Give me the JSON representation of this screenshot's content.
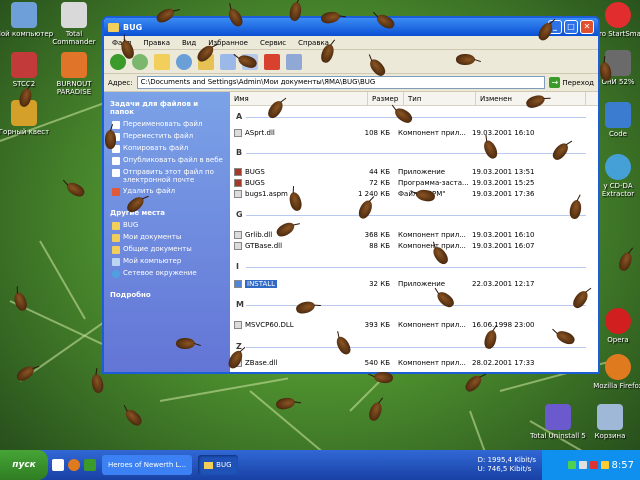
{
  "desktop": {
    "icons": [
      {
        "label": "Мой компьютер",
        "color": "#6f9fd8"
      },
      {
        "label": "Total Commander",
        "color": "#d9d9d9"
      },
      {
        "label": "STCC2",
        "color": "#c23a3a"
      },
      {
        "label": "BURNOUT PARADISE",
        "color": "#e0752a"
      },
      {
        "label": "Горный квест",
        "color": "#d4a02a"
      },
      {
        "label": "Nero StartSmart",
        "color": "#e12d2d"
      },
      {
        "label": "ОнИ 52%",
        "color": "#6a6a6a"
      },
      {
        "label": "Code",
        "color": "#3b7bd0"
      },
      {
        "label": "y CD-DA Extractor",
        "color": "#45a0d8"
      },
      {
        "label": "Opera",
        "color": "#d11f1f"
      },
      {
        "label": "Mozilla Firefox",
        "color": "#e07a1f"
      },
      {
        "label": "Total Uninstall 5",
        "color": "#6a5acd"
      },
      {
        "label": "Корзина",
        "color": "#9fb8d8"
      }
    ]
  },
  "window": {
    "title": "BUG",
    "menu": [
      "Файл",
      "Правка",
      "Вид",
      "Избранное",
      "Сервис",
      "Справка"
    ],
    "address_label": "Адрес:",
    "address_value": "C:\\Documents and Settings\\Admin\\Мои документы\\ЯМА\\BUG\\BUG",
    "go_label": "Переход"
  },
  "taskpane": {
    "file_tasks_title": "Задачи для файлов и папок",
    "file_tasks": [
      "Переименовать файл",
      "Переместить файл",
      "Копировать файл",
      "Опубликовать файл в вебе",
      "Отправить этот файл по электронной почте",
      "Удалить файл"
    ],
    "other_places_title": "Другие места",
    "other_places": [
      "BUG",
      "Мои документы",
      "Общие документы",
      "Мой компьютер",
      "Сетевое окружение"
    ],
    "details_title": "Подробно"
  },
  "filelist": {
    "columns": {
      "name": "Имя",
      "size": "Размер",
      "type": "Тип",
      "modified": "Изменен"
    },
    "groups": [
      {
        "letter": "A",
        "files": [
          {
            "name": "ASprt.dll",
            "size": "108 КБ",
            "type": "Компонент прил...",
            "date": "19.03.2001 16:10"
          }
        ]
      },
      {
        "letter": "B",
        "files": [
          {
            "name": "BUGS",
            "size": "44 КБ",
            "type": "Приложение",
            "date": "19.03.2001 13:51"
          },
          {
            "name": "BUGS",
            "size": "72 КБ",
            "type": "Программа-заста...",
            "date": "19.03.2001 15:25"
          },
          {
            "name": "bugs1.aspm",
            "size": "1 240 КБ",
            "type": "Файл \"ASPM\"",
            "date": "19.03.2001 17:36"
          }
        ]
      },
      {
        "letter": "G",
        "files": [
          {
            "name": "Grlib.dll",
            "size": "368 КБ",
            "type": "Компонент прил...",
            "date": "19.03.2001 16:10"
          },
          {
            "name": "GTBase.dll",
            "size": "88 КБ",
            "type": "Компонент прил...",
            "date": "19.03.2001 16:07"
          }
        ]
      },
      {
        "letter": "I",
        "files": [
          {
            "name": "INSTALL",
            "size": "32 КБ",
            "type": "Приложение",
            "date": "22.03.2001 12:17",
            "selected": true
          }
        ]
      },
      {
        "letter": "M",
        "files": [
          {
            "name": "MSVCP60.DLL",
            "size": "393 КБ",
            "type": "Компонент прил...",
            "date": "16.06.1998 23:00"
          }
        ]
      },
      {
        "letter": "Z",
        "files": [
          {
            "name": "ZBase.dll",
            "size": "540 КБ",
            "type": "Компонент прил...",
            "date": "28.02.2001 17:33"
          }
        ]
      }
    ]
  },
  "taskbar": {
    "start_label": "пуск",
    "tasks": [
      {
        "label": "Heroes of Newerth L..."
      },
      {
        "label": "BUG"
      }
    ],
    "net": {
      "down": "D:    1995,4 Kibit/s",
      "up": "U:      746,5 Kibit/s"
    },
    "clock": "8:57"
  }
}
